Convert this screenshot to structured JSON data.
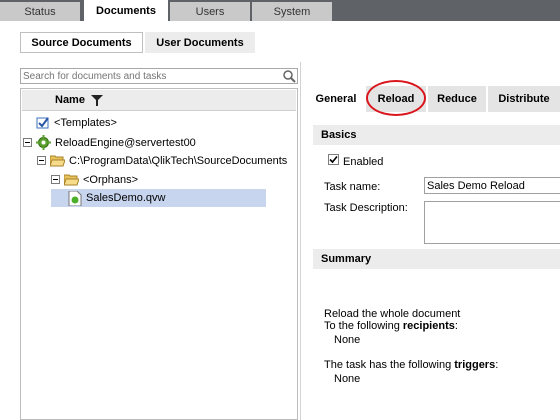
{
  "top_tabs": [
    "Status",
    "Documents",
    "Users",
    "System"
  ],
  "sub_tabs": [
    "Source Documents",
    "User Documents"
  ],
  "search": {
    "placeholder": "Search for documents and tasks"
  },
  "tree": {
    "column_header": "Name",
    "items": [
      {
        "label": "<Templates>",
        "icon": "templates-icon"
      },
      {
        "label": "ReloadEngine@servertest00",
        "icon": "gear-icon"
      },
      {
        "label": "C:\\ProgramData\\QlikTech\\SourceDocuments",
        "icon": "folder-open-icon"
      },
      {
        "label": "<Orphans>",
        "icon": "folder-open-icon"
      },
      {
        "label": "SalesDemo.qvw",
        "icon": "qvw-document-icon",
        "selected": true
      }
    ]
  },
  "right_tabs": [
    "General",
    "Reload",
    "Reduce",
    "Distribute"
  ],
  "basics": {
    "header": "Basics",
    "enabled_label": "Enabled",
    "enabled_checked": true,
    "task_name_label": "Task name:",
    "task_name_value": "Sales Demo Reload",
    "task_description_label": "Task Description:",
    "task_description_value": ""
  },
  "summary": {
    "header": "Summary",
    "line1": "Reload the whole document",
    "line2_prefix": "To the following ",
    "line2_bold": "recipients",
    "line2_suffix": ":",
    "recipients_value": "None",
    "line3_prefix": "The task has the following ",
    "line3_bold": "triggers",
    "line3_suffix": ":",
    "triggers_value": "None"
  },
  "colors": {
    "highlight_oval": "#d9151b",
    "topbar": "#5f6368",
    "selected_row": "#c7d5ee"
  }
}
